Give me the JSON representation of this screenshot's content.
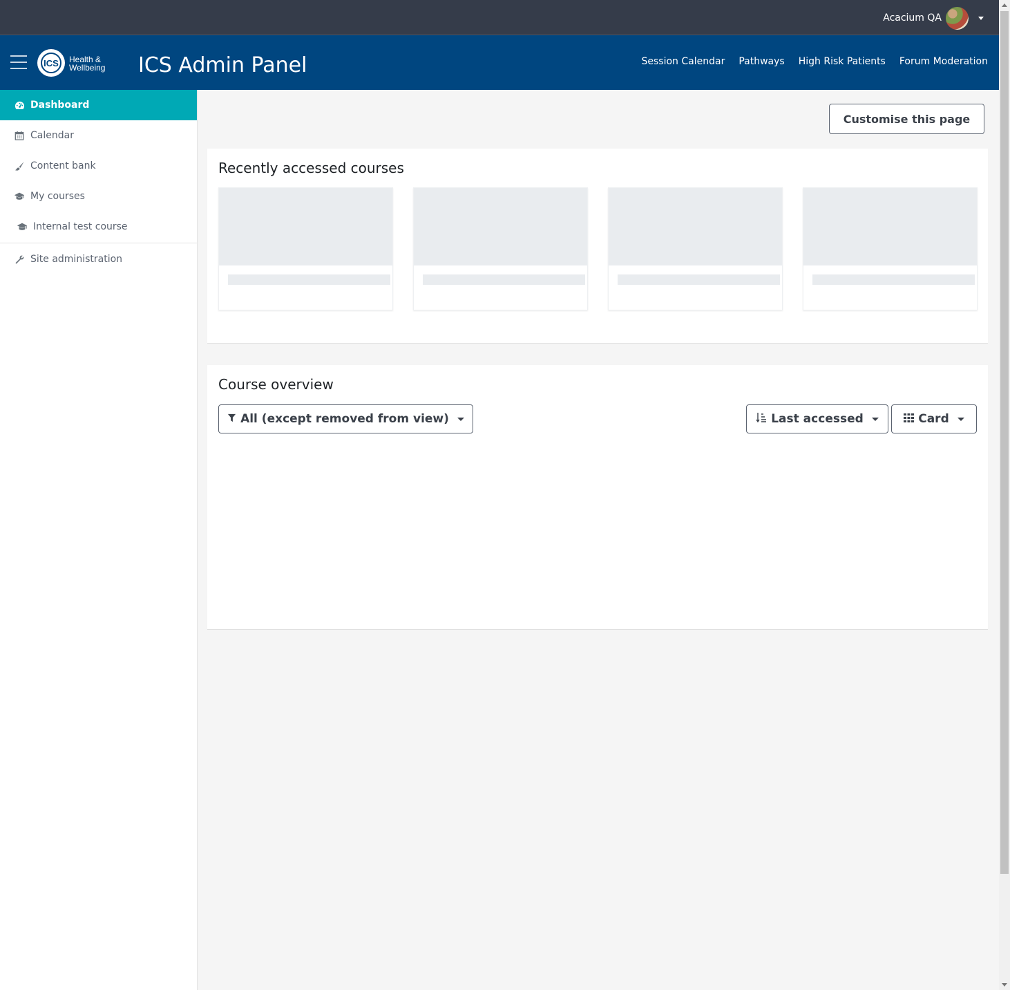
{
  "user_menu": {
    "name": "Acacium QA"
  },
  "navbar": {
    "logo_text_line1": "Health &",
    "logo_text_line2": "Wellbeing",
    "logo_initials": "ICS",
    "title": "ICS Admin Panel",
    "links": [
      "Session Calendar",
      "Pathways",
      "High Risk Patients",
      "Forum Moderation"
    ]
  },
  "sidebar": {
    "items": [
      {
        "label": "Dashboard",
        "icon": "dashboard-icon",
        "active": true
      },
      {
        "label": "Calendar",
        "icon": "calendar-icon"
      },
      {
        "label": "Content bank",
        "icon": "paint-brush-icon"
      },
      {
        "label": "My courses",
        "icon": "graduation-cap-icon"
      },
      {
        "label": "Internal test course",
        "icon": "graduation-cap-icon"
      },
      {
        "label": "Site administration",
        "icon": "wrench-icon"
      }
    ]
  },
  "main": {
    "customise_label": "Customise this page",
    "recent": {
      "title": "Recently accessed courses"
    },
    "overview": {
      "title": "Course overview",
      "filter_label": "All (except removed from view)",
      "sort_label": "Last accessed",
      "view_label": "Card"
    }
  },
  "colors": {
    "topbar": "#353c4a",
    "navbar": "#004680",
    "active_item": "#00a9b5"
  }
}
